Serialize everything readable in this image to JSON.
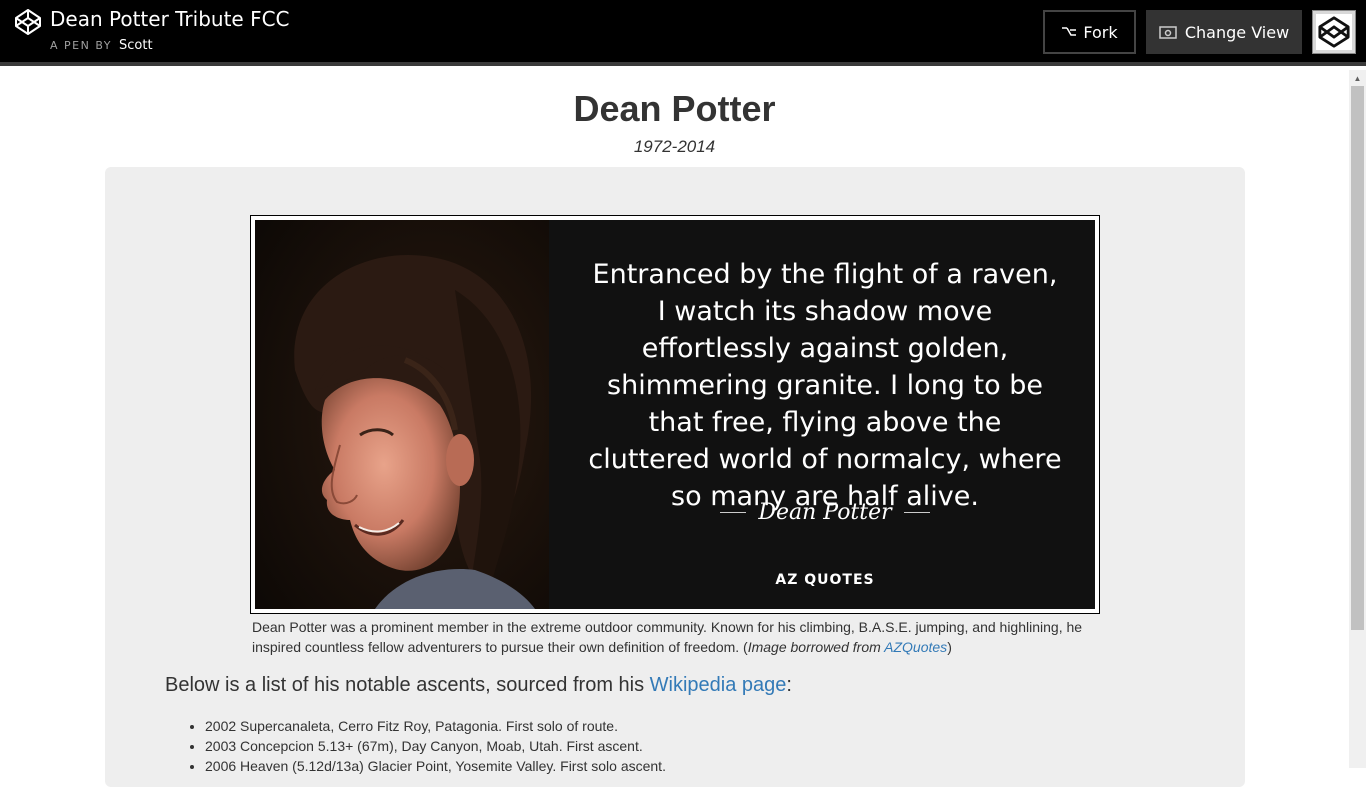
{
  "header": {
    "title": "Dean Potter Tribute FCC",
    "byline_prefix": "A PEN BY",
    "author": "Scott",
    "fork_label": "Fork",
    "change_view_label": "Change View"
  },
  "page": {
    "title": "Dean Potter",
    "years": "1972-2014"
  },
  "quote": {
    "text": "Entranced by the flight of a raven, I watch its shadow move effortlessly against golden, shimmering granite. I long to be that free, flying above the cluttered world of normalcy, where so many are half alive.",
    "author": "Dean Potter",
    "brand": "AZ QUOTES"
  },
  "caption": {
    "text": "Dean Potter was a prominent member in the extreme outdoor community. Known for his climbing, B.A.S.E. jumping, and highlining, he inspired countless fellow adventurers to pursue their own definition of freedom. ",
    "credit_prefix": "(",
    "credit_italic": "Image borrowed from ",
    "credit_link": "AZQuotes",
    "credit_suffix": ")"
  },
  "ascents_section": {
    "heading_prefix": "Below is a list of his notable ascents, sourced from his ",
    "heading_link": "Wikipedia page",
    "heading_suffix": ":",
    "items": [
      "2002 Supercanaleta, Cerro Fitz Roy, Patagonia. First solo of route.",
      "2003 Concepcion 5.13+ (67m), Day Canyon, Moab, Utah. First ascent.",
      "2006 Heaven (5.12d/13a) Glacier Point, Yosemite Valley. First solo ascent."
    ]
  },
  "colors": {
    "header_bg": "#000000",
    "link": "#337ab7",
    "well_bg": "#eeeeee"
  },
  "icons": {
    "logo": "codepen-logo-icon",
    "fork": "fork-icon",
    "change_view": "eye-icon"
  }
}
